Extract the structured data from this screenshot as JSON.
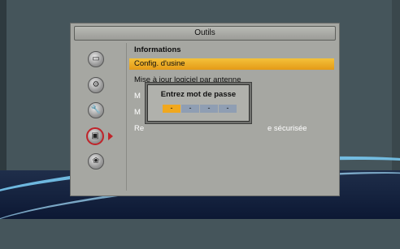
{
  "window": {
    "title": "Outils"
  },
  "menu": {
    "items": [
      {
        "label": "Informations",
        "state": "normal"
      },
      {
        "label": "Config. d'usine",
        "state": "selected"
      },
      {
        "label": "Mise à jour logiciel par antenne",
        "state": "normal"
      },
      {
        "label": "M",
        "state": "partially-hidden"
      },
      {
        "label": "M",
        "state": "partially-hidden"
      },
      {
        "label": "Re",
        "state": "partially-hidden"
      },
      {
        "label": "e sécurisée",
        "state": "partially-hidden"
      }
    ]
  },
  "sidebar": {
    "icons": [
      {
        "name": "screen-icon",
        "selected": false
      },
      {
        "name": "gear-icon",
        "selected": false
      },
      {
        "name": "wrench-icon",
        "selected": false
      },
      {
        "name": "monitor-icon",
        "selected": true
      },
      {
        "name": "film-reel-icon",
        "selected": false
      }
    ]
  },
  "dialog": {
    "title": "Entrez mot de passe",
    "fields": [
      "-",
      "-",
      "-",
      "-"
    ],
    "active_index": 0
  },
  "colors": {
    "highlight": "#e49a17",
    "selection_ring": "#c0242a",
    "password_field": "#8f9eb3"
  }
}
